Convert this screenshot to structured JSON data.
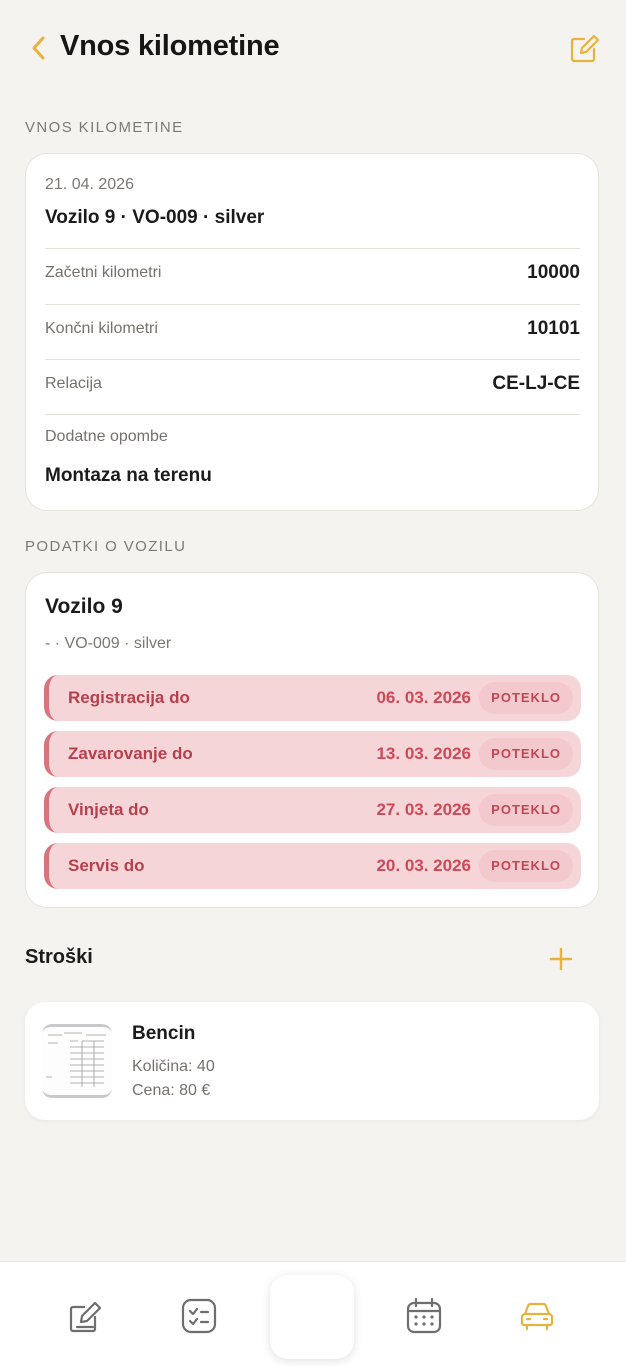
{
  "header": {
    "title": "Vnos kilometine",
    "back_icon": "chevron-left-icon",
    "edit_icon": "edit-icon",
    "accent": "#e8b33c"
  },
  "trip_section": {
    "label": "VNOS KILOMETINE",
    "date": "21. 04. 2026",
    "vehicle_line": "Vozilo 9 · VO-009 · silver",
    "rows": [
      {
        "label": "Začetni kilometri",
        "value": "10000"
      },
      {
        "label": "Končni kilometri",
        "value": "10101"
      },
      {
        "label": "Relacija",
        "value": "CE-LJ-CE"
      }
    ],
    "notes": {
      "label": "Dodatne opombe",
      "value": "Montaza na terenu"
    }
  },
  "vehicle_section": {
    "label": "PODATKI O VOZILU",
    "name": "Vozilo 9",
    "subtitle": "- · VO-009 · silver",
    "alerts": [
      {
        "label": "Registracija do",
        "date": "06. 03. 2026",
        "status": "POTEKLO"
      },
      {
        "label": "Zavarovanje do",
        "date": "13. 03. 2026",
        "status": "POTEKLO"
      },
      {
        "label": "Vinjeta do",
        "date": "27. 03. 2026",
        "status": "POTEKLO"
      },
      {
        "label": "Servis do",
        "date": "20. 03. 2026",
        "status": "POTEKLO"
      }
    ],
    "alert_color": "#cc4a57"
  },
  "costs": {
    "title": "Stroški",
    "add_icon": "plus-icon",
    "items": [
      {
        "name": "Bencin",
        "quantity": "Količina: 40",
        "price": "Cena: 80 €",
        "thumb_icon": "receipt-thumbnail"
      }
    ]
  },
  "bottom_nav": {
    "items": [
      "edit-icon",
      "checklist-icon",
      "home-button",
      "calendar-icon",
      "car-icon"
    ],
    "active": "car-icon"
  }
}
